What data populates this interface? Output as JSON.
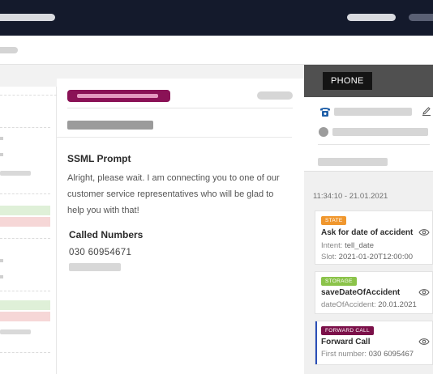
{
  "colors": {
    "topbar": "#141a2c",
    "tag_magenta": "#8a1256",
    "state_badge": "#f0972e",
    "storage_badge": "#8bc34a",
    "forward_badge": "#7b1049",
    "forward_bar": "#2b4fb8",
    "phone_icon": "#1f5fa8"
  },
  "card": {
    "ssml_title": "SSML Prompt",
    "ssml_text": "Alright, please wait. I am connecting you to one of our customer service representatives who will be glad to help you with that!",
    "called_title": "Called Numbers",
    "called_number": "030 60954671"
  },
  "right_panel": {
    "tab_label": "PHONE",
    "icons": [
      "phone-icon",
      "edit-icon",
      "avatar"
    ],
    "timestamp": "11:34:10 - 21.01.2021",
    "events": [
      {
        "badge": "STATE",
        "title": "Ask for date of accident",
        "lines": [
          {
            "label": "Intent:",
            "value": "tell_date"
          },
          {
            "label": "Slot:",
            "value": "2021-01-20T12:00:00"
          }
        ],
        "icon": "eye-icon"
      },
      {
        "badge": "STORAGE",
        "title": "saveDateOfAccident",
        "lines": [
          {
            "label": "dateOfAccident:",
            "value": "20.01.2021"
          }
        ],
        "icon": "eye-icon"
      },
      {
        "badge": "FORWARD CALL",
        "title": "Forward Call",
        "lines": [
          {
            "label": "First number:",
            "value": "030 6095467"
          }
        ],
        "icon": "eye-icon"
      }
    ]
  }
}
